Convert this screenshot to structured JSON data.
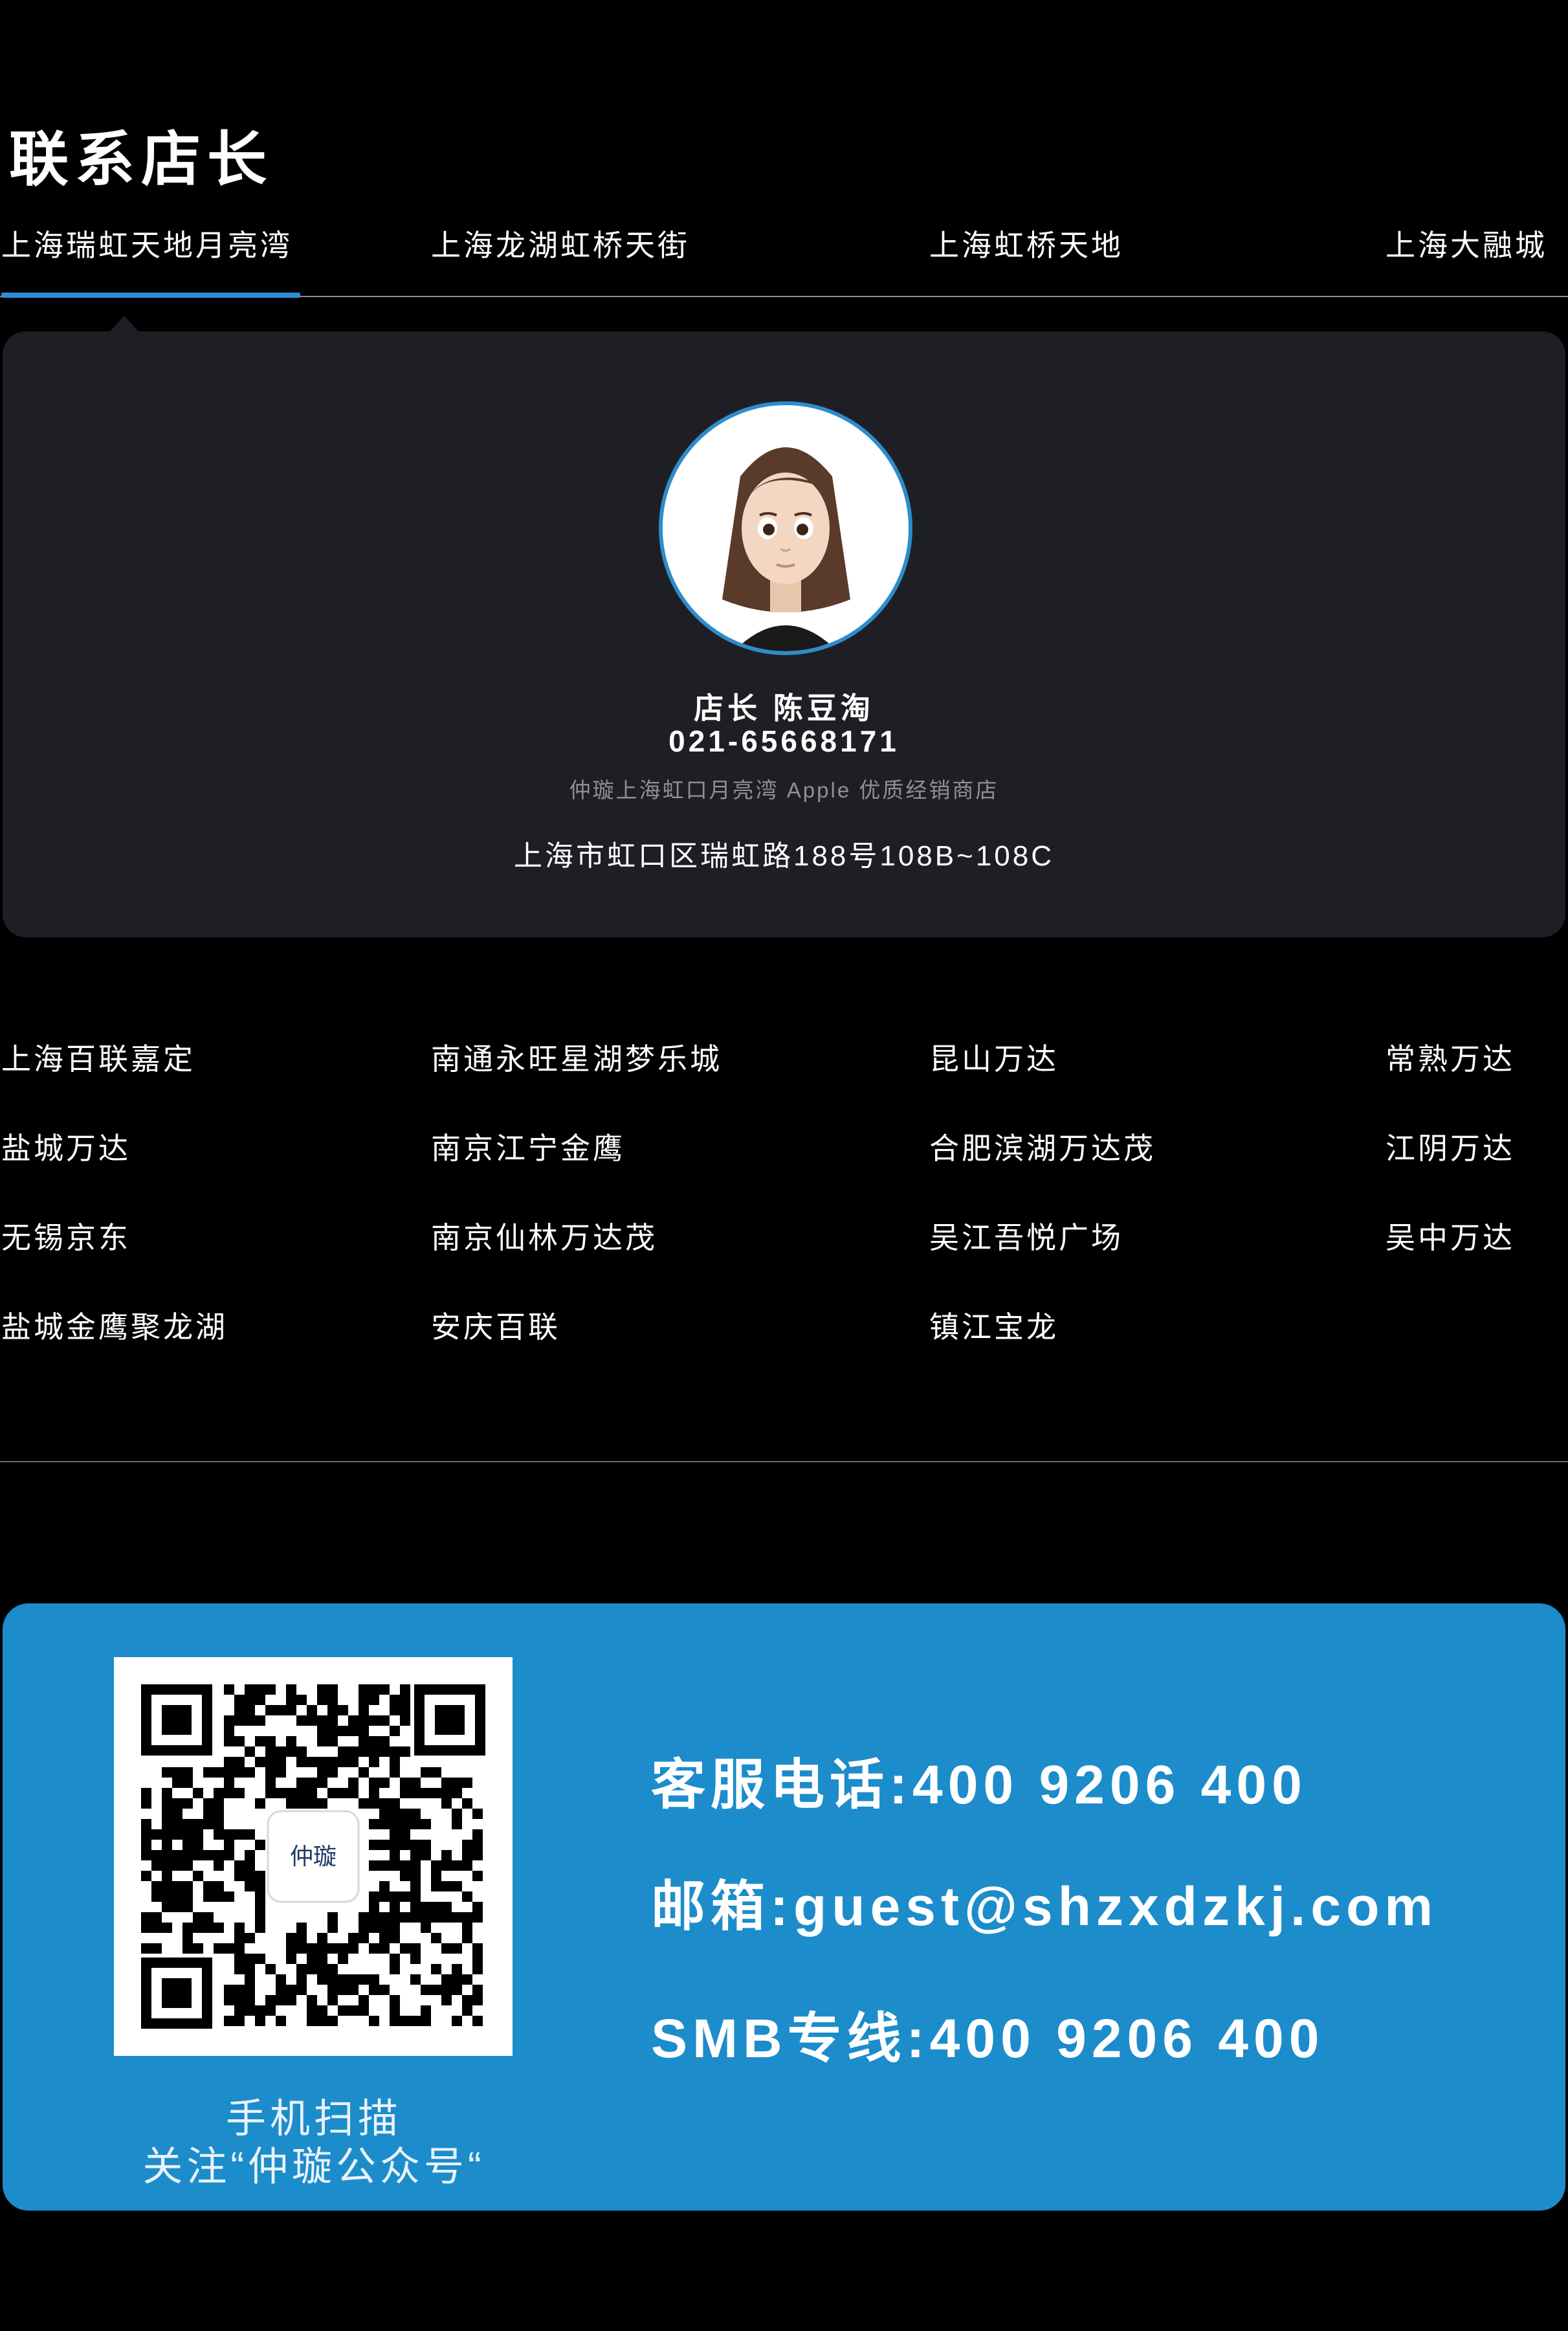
{
  "section": {
    "title": "联系店长"
  },
  "tabs": [
    {
      "label": "上海瑞虹天地月亮湾",
      "active": true
    },
    {
      "label": "上海龙湖虹桥天街",
      "active": false
    },
    {
      "label": "上海虹桥天地",
      "active": false
    },
    {
      "label": "上海大融城",
      "active": false
    }
  ],
  "manager_card": {
    "name_line": "店长 陈豆淘",
    "phone": "021-65668171",
    "store_desc": "仲璇上海虹口月亮湾 Apple 优质经销商店",
    "address": "上海市虹口区瑞虹路188号108B~108C"
  },
  "stores": {
    "col1": [
      "上海百联嘉定",
      "盐城万达",
      "无锡京东",
      "盐城金鹰聚龙湖"
    ],
    "col2": [
      "南通永旺星湖梦乐城",
      "南京江宁金鹰",
      "南京仙林万达茂",
      "安庆百联"
    ],
    "col3": [
      "昆山万达",
      "合肥滨湖万达茂",
      "吴江吾悦广场",
      "镇江宝龙"
    ],
    "col4": [
      "常熟万达",
      "江阴万达",
      "吴中万达"
    ]
  },
  "contact": {
    "hotline": "客服电话:400 9206 400",
    "email": "邮箱:guest@shzxdzkj.com",
    "smb": "SMB专线:400 9206 400",
    "qr_logo_text": "仲璇",
    "qr_caption_1": "手机扫描",
    "qr_caption_2": "关注“仲璇公众号“"
  },
  "colors": {
    "accent": "#2c8fd6",
    "card_bg": "#1e1f24",
    "contact_bg": "#1c8ccb"
  }
}
